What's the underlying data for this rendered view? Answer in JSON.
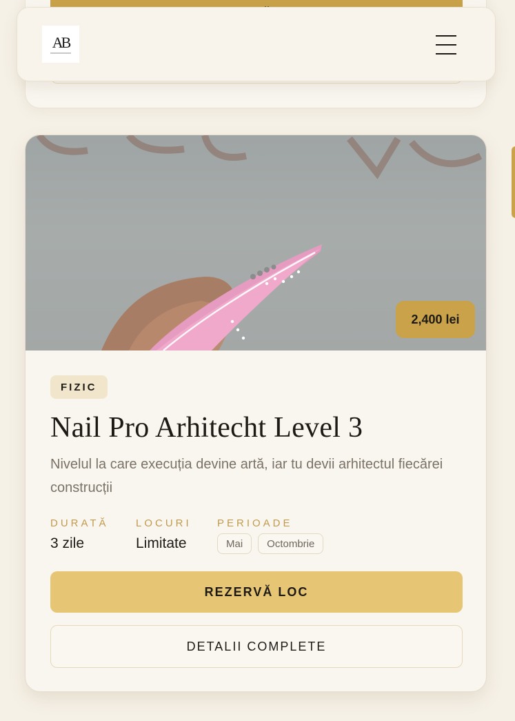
{
  "previous_card": {
    "reserve_label": "REZERVĂ LOC"
  },
  "header": {
    "logo_text": "AB",
    "menu_icon": "hamburger-menu-icon"
  },
  "course": {
    "image_alt": "pink-nail-art-photo",
    "price": "2,400 lei",
    "format": "FIZIC",
    "title": "Nail Pro Arhitecht Level 3",
    "description": "Nivelul la care execuția devine artă, iar tu devii arhitectul fiecărei construcții",
    "duration_label": "DURATĂ",
    "duration_value": "3 zile",
    "seats_label": "LOCURI",
    "seats_value": "Limitate",
    "periods_label": "PERIOADE",
    "periods": [
      "Mai",
      "Octombrie"
    ],
    "reserve_label": "REZERVĂ LOC",
    "details_label": "DETALII COMPLETE"
  },
  "colors": {
    "background": "#f6f1e7",
    "card": "#f9f6f0",
    "accent_gold": "#c9a24a",
    "button_gold": "#e6c574",
    "label_gold": "#c29a4c",
    "badge_bg": "#f1e6cc",
    "text_dark": "#1d1a16",
    "text_muted": "#7a7166"
  }
}
